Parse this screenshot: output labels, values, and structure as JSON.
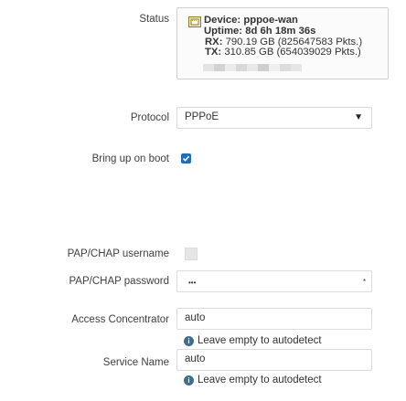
{
  "status": {
    "label": "Status",
    "device_label": "Device:",
    "device_value": "pppoe-wan",
    "uptime_label": "Uptime:",
    "uptime_value": "8d 6h 18m 36s",
    "rx_label": "RX:",
    "rx_value": "790.19 GB (825647583 Pkts.)",
    "tx_label": "TX:",
    "tx_value": "310.85 GB (654039029 Pkts.)"
  },
  "protocol": {
    "label": "Protocol",
    "value": "PPPoE"
  },
  "boot": {
    "label": "Bring up on boot",
    "checked": true
  },
  "username": {
    "label": "PAP/CHAP username",
    "value": ""
  },
  "password": {
    "label": "PAP/CHAP password",
    "value": "•••",
    "reveal": "*"
  },
  "concentrator": {
    "label": "Access Concentrator",
    "value": "auto",
    "hint": "Leave empty to autodetect"
  },
  "service": {
    "label": "Service Name",
    "value": "auto",
    "hint": "Leave empty to autodetect"
  },
  "colors": {
    "accent": "#1e6fb5",
    "text": "#404040",
    "border": "#d9d9d9"
  },
  "icons": {
    "device": "ethernet-port-icon",
    "dropdown": "chevron-down-icon",
    "info": "info-icon"
  }
}
